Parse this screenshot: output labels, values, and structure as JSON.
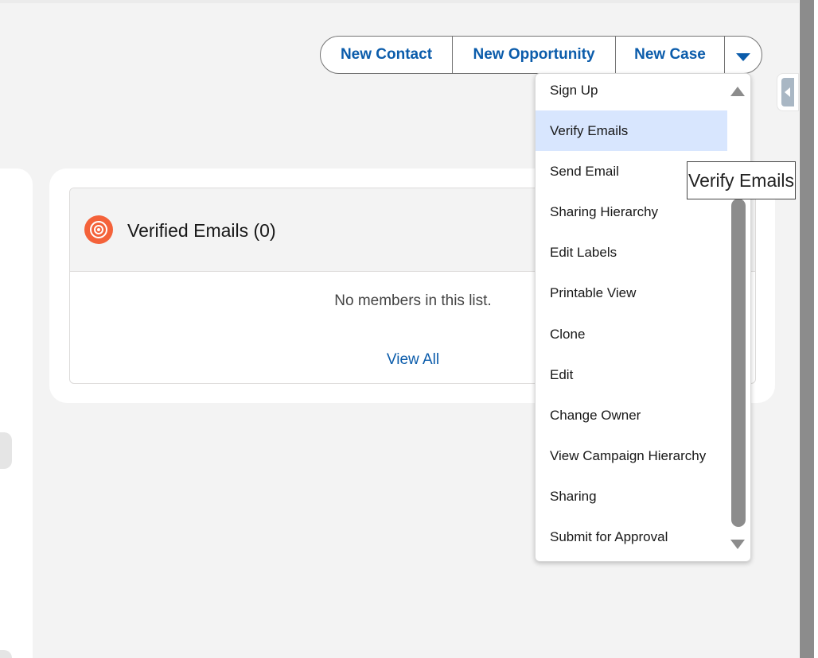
{
  "actions": {
    "new_contact": "New Contact",
    "new_opportunity": "New Opportunity",
    "new_case": "New Case"
  },
  "related_list": {
    "title": "Verified Emails (0)",
    "empty_message": "No members in this list.",
    "view_all": "View All",
    "icon": "campaign-target-icon",
    "icon_color": "#f4623a"
  },
  "menu": {
    "items": [
      {
        "label": "Sign Up"
      },
      {
        "label": "Verify Emails"
      },
      {
        "label": "Send Email"
      },
      {
        "label": "Sharing Hierarchy"
      },
      {
        "label": "Edit Labels"
      },
      {
        "label": "Printable View"
      },
      {
        "label": "Clone"
      },
      {
        "label": "Edit"
      },
      {
        "label": "Change Owner"
      },
      {
        "label": "View Campaign Hierarchy"
      },
      {
        "label": "Sharing"
      },
      {
        "label": "Submit for Approval"
      }
    ],
    "highlighted_item": "Verify Emails"
  },
  "tooltip": {
    "text": "Verify Emails"
  },
  "colors": {
    "link": "#0b5cab",
    "highlight": "#d8e6fe",
    "background": "#f3f3f3"
  }
}
